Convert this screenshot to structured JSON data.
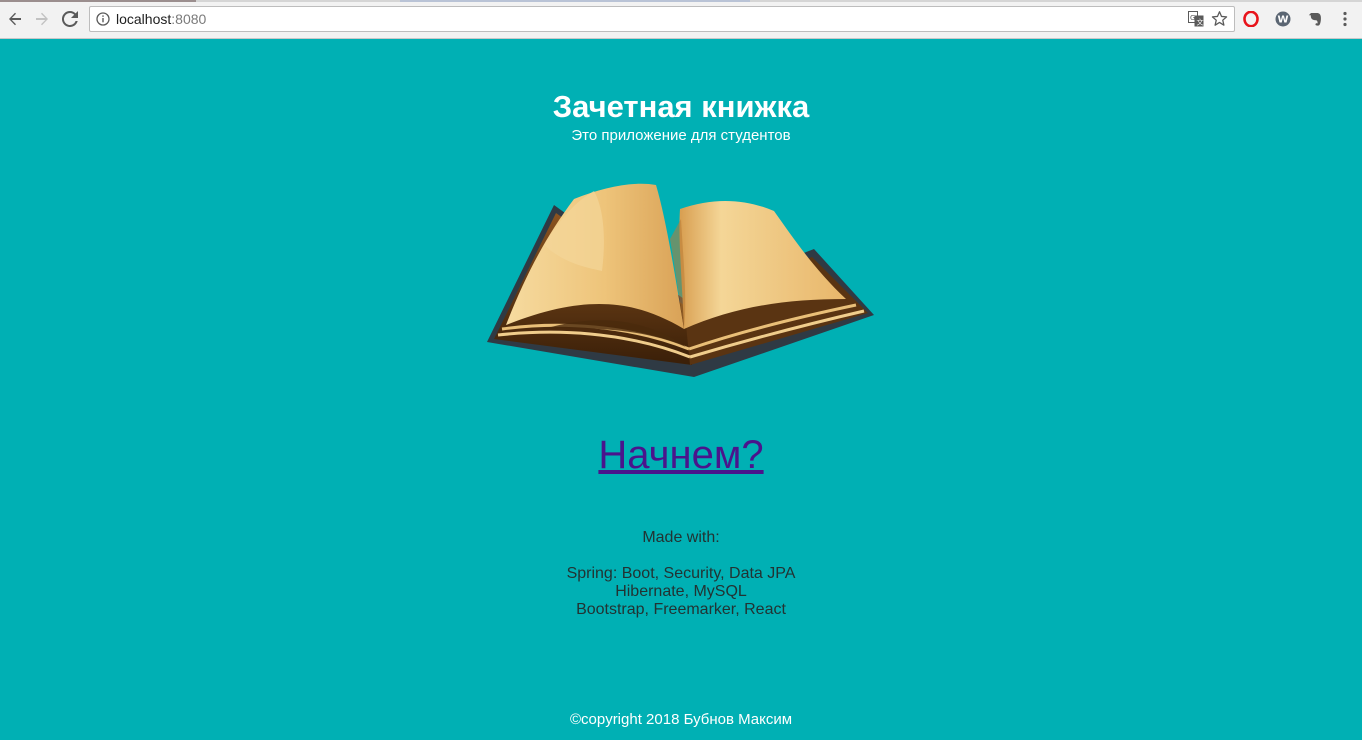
{
  "browser": {
    "url_host": "localhost",
    "url_port": ":8080"
  },
  "page": {
    "title": "Зачетная книжка",
    "subtitle": "Это приложение для студентов",
    "start_link": "Начнем?",
    "made_with_label": "Made with:",
    "tech_lines": [
      "Spring: Boot, Security, Data JPA",
      "Hibernate, MySQL",
      "Bootstrap, Freemarker, React"
    ],
    "footer": "©copyright 2018 Бубнов Максим"
  },
  "colors": {
    "background": "#00b0b4",
    "link": "#4a148c",
    "text_dark": "#223333"
  },
  "icons": {
    "back": "back-arrow-icon",
    "forward": "forward-arrow-icon",
    "reload": "reload-icon",
    "info": "info-icon",
    "translate": "translate-icon",
    "bookmark": "star-icon",
    "extensions": [
      "opera-icon",
      "w-extension-icon",
      "evernote-icon"
    ],
    "menu": "menu-dots-icon",
    "illustration": "open-book-image"
  }
}
